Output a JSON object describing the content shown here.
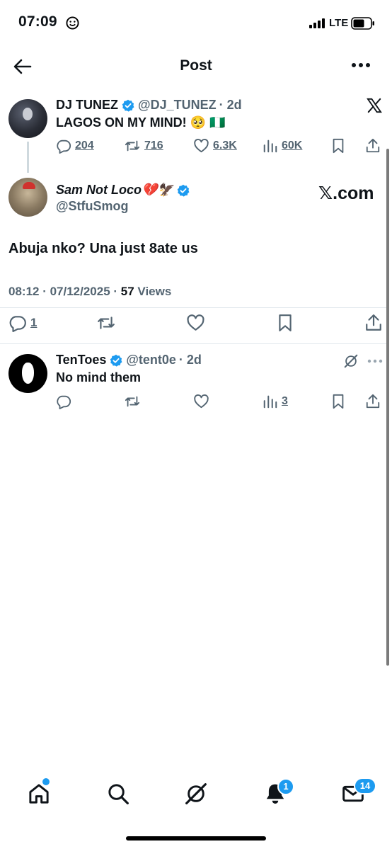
{
  "status_bar": {
    "time": "07:09",
    "network": "LTE"
  },
  "header": {
    "title": "Post"
  },
  "parent_tweet": {
    "display_name": "DJ TUNEZ",
    "handle": "@DJ_TUNEZ",
    "age": "· 2d",
    "text": "LAGOS ON MY MIND! 🥺 🇳🇬",
    "replies": "204",
    "retweets": "716",
    "likes": "6.3K",
    "views": "60K"
  },
  "main_tweet": {
    "display_name": "Sam Not Loco💔🦅",
    "handle": "@StfuSmog",
    "xcom_label": "𝕏.com",
    "text": "Abuja nko? Una just 8ate us",
    "timestamp": "08:12 · 07/12/2025 · ",
    "views_count": "57",
    "views_label": " Views",
    "replies": "1"
  },
  "reply": {
    "display_name": "TenToes",
    "handle": "@tent0e",
    "age": "· 2d",
    "text": "No mind them",
    "views": "3"
  },
  "nav": {
    "notifications_badge": "1",
    "messages_badge": "14"
  },
  "colors": {
    "accent": "#1d9bf0",
    "secondary_text": "#536471",
    "primary_text": "#0f1419"
  }
}
